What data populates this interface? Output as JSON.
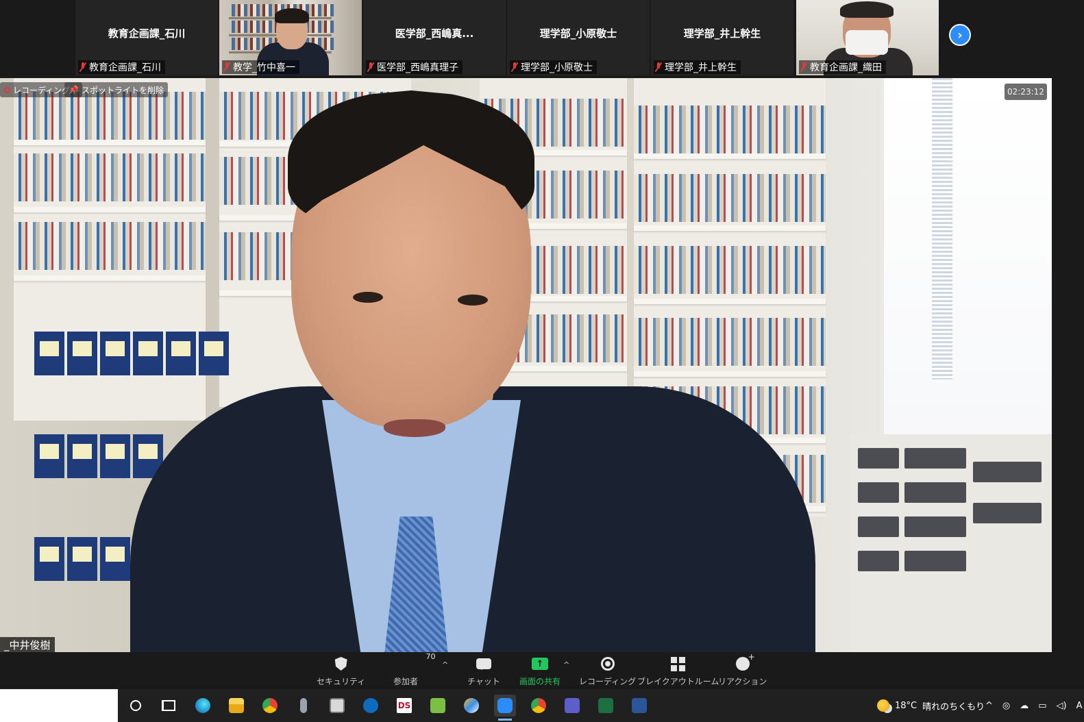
{
  "participants": [
    {
      "center_name": "教育企画課_石川",
      "label": "教育企画課_石川",
      "video": false
    },
    {
      "center_name": "",
      "label": "教学_竹中喜一",
      "video": true
    },
    {
      "center_name": "医学部_西嶋真...",
      "label": "医学部_西嶋真理子",
      "video": false
    },
    {
      "center_name": "理学部_小原敬士",
      "label": "理学部_小原敬士",
      "video": false
    },
    {
      "center_name": "理学部_井上幹生",
      "label": "理学部_井上幹生",
      "video": false
    },
    {
      "center_name": "",
      "label": "教育企画課_織田",
      "video": true
    }
  ],
  "main": {
    "recording_label": "レコーディング中",
    "spotlight_label": "スポットライトを削除",
    "timer": "02:23:12",
    "speaker_name": "_中井俊樹"
  },
  "toolbar": {
    "security": "セキュリティ",
    "participants": "参加者",
    "participants_count": "70",
    "chat": "チャット",
    "share": "画面の共有",
    "recording": "レコーディング",
    "breakout": "ブレイクアウトルーム",
    "reactions": "リアクション",
    "share_color": "#22c55e"
  },
  "taskbar": {
    "weather_temp": "18°C",
    "weather_text": "晴れのちくもり",
    "tray_extra": "A",
    "apps": [
      "edge",
      "file-explorer",
      "chrome",
      "microphone-app",
      "mail-app",
      "outlook",
      "ds-app",
      "green-app",
      "paint-app",
      "zoom",
      "chrome-profile",
      "teams",
      "excel",
      "word"
    ]
  },
  "colors": {
    "zoom_blue": "#2d8cff",
    "record_red": "#e03a3a"
  }
}
